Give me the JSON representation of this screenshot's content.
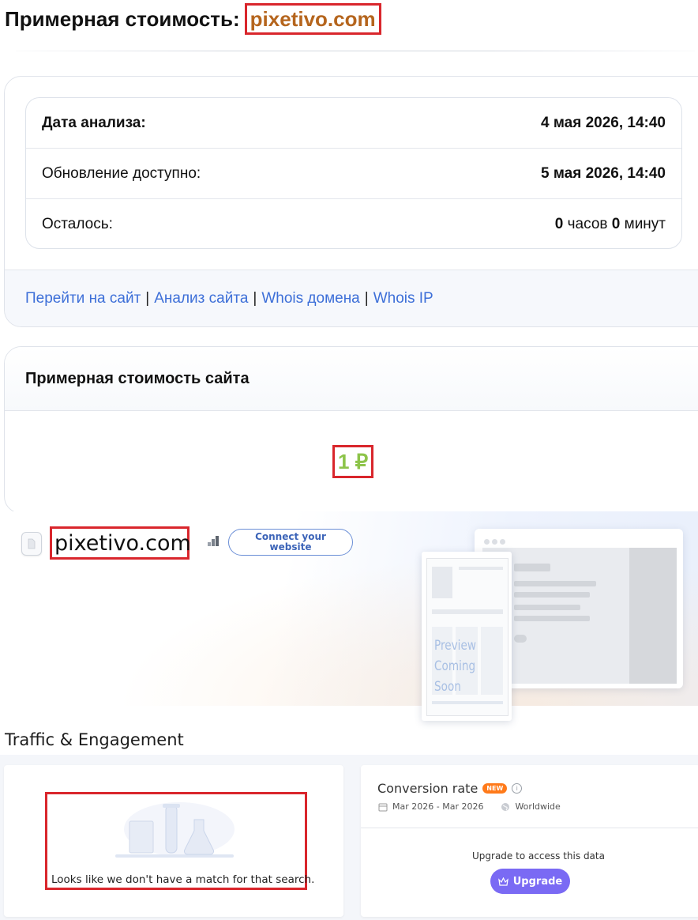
{
  "header": {
    "title_prefix": "Примерная стоимость:",
    "domain": "pixetivo.com"
  },
  "analysis": {
    "rows": [
      {
        "label": "Дата анализа:",
        "value": "4 мая 2026, 14:40"
      },
      {
        "label": "Обновление доступно:",
        "value": "5 мая 2026, 14:40"
      },
      {
        "label": "Осталось:",
        "hours_num": "0",
        "hours_unit": "часов",
        "minutes_num": "0",
        "minutes_unit": "минут"
      }
    ],
    "links": [
      "Перейти на сайт",
      "Анализ сайта",
      "Whois домена",
      "Whois IP"
    ],
    "separator": "|"
  },
  "value_card": {
    "title": "Примерная стоимость сайта",
    "price": "1 ₽",
    "price_color": "#8dc44a"
  },
  "hero": {
    "domain": "pixetivo.com",
    "connect_line1": "Connect your",
    "connect_line2": "website",
    "preview_line1": "Preview",
    "preview_line2": "Coming Soon",
    "icons": [
      "document-icon",
      "bar-chart-icon"
    ]
  },
  "traffic": {
    "section_title": "Traffic & Engagement",
    "no_match": "Looks like we don't have a match for that search.",
    "conversion": {
      "title": "Conversion rate",
      "badge": "NEW",
      "date_range": "Mar 2026 - Mar 2026",
      "region": "Worldwide",
      "upgrade_prompt": "Upgrade to access this data",
      "upgrade_label": "Upgrade"
    }
  },
  "colors": {
    "highlight_border": "#d9262c",
    "link": "#3d6fd8",
    "upgrade": "#7a6af4",
    "badge": "#ff7a1a"
  }
}
